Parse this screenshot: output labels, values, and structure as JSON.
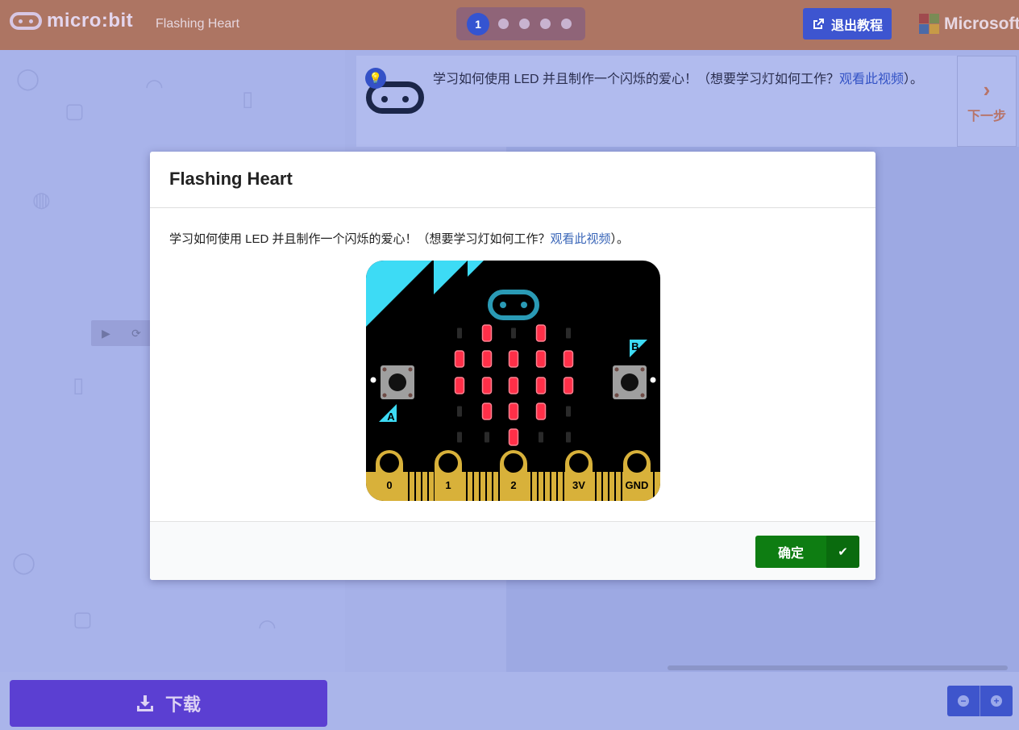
{
  "header": {
    "logo_text": "micro:bit",
    "tutorial_name": "Flashing Heart",
    "steps": [
      {
        "label": "1",
        "active": true
      },
      {
        "label": "",
        "active": false
      },
      {
        "label": "",
        "active": false
      },
      {
        "label": "",
        "active": false
      },
      {
        "label": "",
        "active": false
      }
    ],
    "exit_label": "退出教程",
    "brand_text": "Microsoft",
    "colors": {
      "header_bg": "#ad7563",
      "accent": "#3d55d0"
    }
  },
  "tutorial_card": {
    "text": "学习如何使用 LED 并且制作一个闪烁的爱心！（想要学习灯如何工作？",
    "link_text": "观看此视频",
    "suffix": "）。",
    "next_label": "下一步",
    "next_icon": "chevron-right-icon"
  },
  "bottom": {
    "download_label": "下载",
    "download_icon": "download-icon",
    "zoom_out_icon": "zoom-out-icon",
    "zoom_in_icon": "zoom-in-icon"
  },
  "modal": {
    "title": "Flashing Heart",
    "desc_text": "学习如何使用 LED 并且制作一个闪烁的爱心！（想要学习灯如何工作？",
    "link_text": "观看此视频",
    "desc_suffix": "）。",
    "ok_label": "确定",
    "ok_icon": "checkmark-icon",
    "board": {
      "button_a": "A",
      "button_b": "B",
      "pins": [
        "0",
        "1",
        "2",
        "3V",
        "GND"
      ],
      "led_grid": [
        [
          0,
          1,
          0,
          1,
          0
        ],
        [
          1,
          1,
          1,
          1,
          1
        ],
        [
          1,
          1,
          1,
          1,
          1
        ],
        [
          0,
          1,
          1,
          1,
          0
        ],
        [
          0,
          0,
          1,
          0,
          0
        ]
      ],
      "colors": {
        "board": "#000000",
        "led_on": "#ff2f48",
        "led_off": "#2a2a2a",
        "accent": "#3ddbf5",
        "gold": "#d8b13a"
      }
    }
  }
}
